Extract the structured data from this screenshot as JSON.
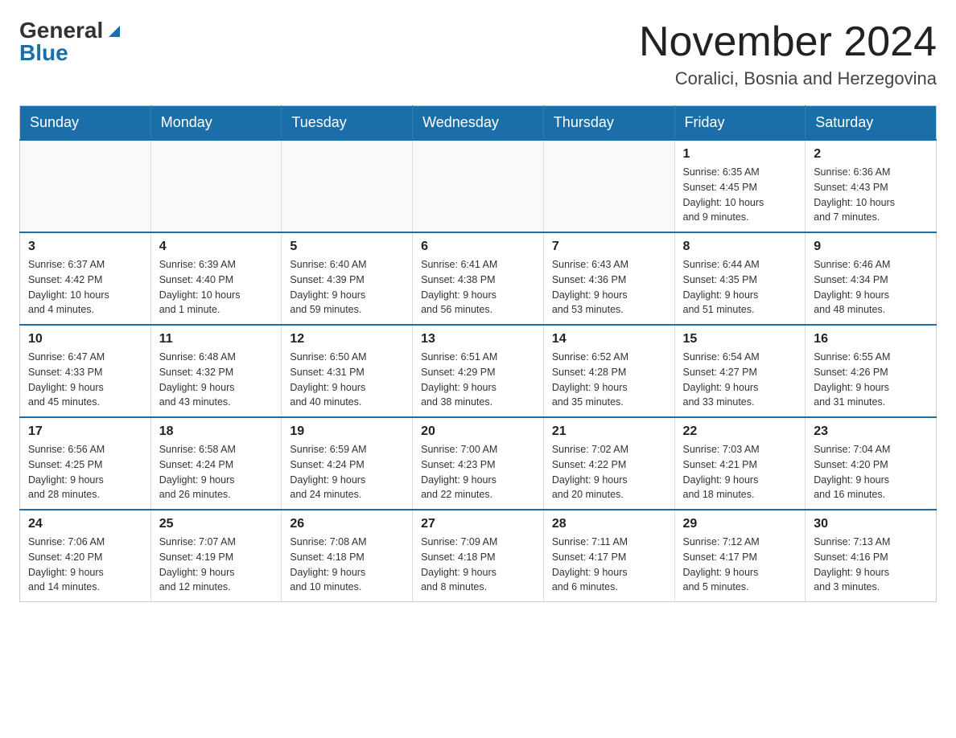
{
  "logo": {
    "general": "General",
    "blue": "Blue"
  },
  "title": {
    "month": "November 2024",
    "location": "Coralici, Bosnia and Herzegovina"
  },
  "days_of_week": [
    "Sunday",
    "Monday",
    "Tuesday",
    "Wednesday",
    "Thursday",
    "Friday",
    "Saturday"
  ],
  "weeks": [
    [
      {
        "day": "",
        "info": ""
      },
      {
        "day": "",
        "info": ""
      },
      {
        "day": "",
        "info": ""
      },
      {
        "day": "",
        "info": ""
      },
      {
        "day": "",
        "info": ""
      },
      {
        "day": "1",
        "info": "Sunrise: 6:35 AM\nSunset: 4:45 PM\nDaylight: 10 hours\nand 9 minutes."
      },
      {
        "day": "2",
        "info": "Sunrise: 6:36 AM\nSunset: 4:43 PM\nDaylight: 10 hours\nand 7 minutes."
      }
    ],
    [
      {
        "day": "3",
        "info": "Sunrise: 6:37 AM\nSunset: 4:42 PM\nDaylight: 10 hours\nand 4 minutes."
      },
      {
        "day": "4",
        "info": "Sunrise: 6:39 AM\nSunset: 4:40 PM\nDaylight: 10 hours\nand 1 minute."
      },
      {
        "day": "5",
        "info": "Sunrise: 6:40 AM\nSunset: 4:39 PM\nDaylight: 9 hours\nand 59 minutes."
      },
      {
        "day": "6",
        "info": "Sunrise: 6:41 AM\nSunset: 4:38 PM\nDaylight: 9 hours\nand 56 minutes."
      },
      {
        "day": "7",
        "info": "Sunrise: 6:43 AM\nSunset: 4:36 PM\nDaylight: 9 hours\nand 53 minutes."
      },
      {
        "day": "8",
        "info": "Sunrise: 6:44 AM\nSunset: 4:35 PM\nDaylight: 9 hours\nand 51 minutes."
      },
      {
        "day": "9",
        "info": "Sunrise: 6:46 AM\nSunset: 4:34 PM\nDaylight: 9 hours\nand 48 minutes."
      }
    ],
    [
      {
        "day": "10",
        "info": "Sunrise: 6:47 AM\nSunset: 4:33 PM\nDaylight: 9 hours\nand 45 minutes."
      },
      {
        "day": "11",
        "info": "Sunrise: 6:48 AM\nSunset: 4:32 PM\nDaylight: 9 hours\nand 43 minutes."
      },
      {
        "day": "12",
        "info": "Sunrise: 6:50 AM\nSunset: 4:31 PM\nDaylight: 9 hours\nand 40 minutes."
      },
      {
        "day": "13",
        "info": "Sunrise: 6:51 AM\nSunset: 4:29 PM\nDaylight: 9 hours\nand 38 minutes."
      },
      {
        "day": "14",
        "info": "Sunrise: 6:52 AM\nSunset: 4:28 PM\nDaylight: 9 hours\nand 35 minutes."
      },
      {
        "day": "15",
        "info": "Sunrise: 6:54 AM\nSunset: 4:27 PM\nDaylight: 9 hours\nand 33 minutes."
      },
      {
        "day": "16",
        "info": "Sunrise: 6:55 AM\nSunset: 4:26 PM\nDaylight: 9 hours\nand 31 minutes."
      }
    ],
    [
      {
        "day": "17",
        "info": "Sunrise: 6:56 AM\nSunset: 4:25 PM\nDaylight: 9 hours\nand 28 minutes."
      },
      {
        "day": "18",
        "info": "Sunrise: 6:58 AM\nSunset: 4:24 PM\nDaylight: 9 hours\nand 26 minutes."
      },
      {
        "day": "19",
        "info": "Sunrise: 6:59 AM\nSunset: 4:24 PM\nDaylight: 9 hours\nand 24 minutes."
      },
      {
        "day": "20",
        "info": "Sunrise: 7:00 AM\nSunset: 4:23 PM\nDaylight: 9 hours\nand 22 minutes."
      },
      {
        "day": "21",
        "info": "Sunrise: 7:02 AM\nSunset: 4:22 PM\nDaylight: 9 hours\nand 20 minutes."
      },
      {
        "day": "22",
        "info": "Sunrise: 7:03 AM\nSunset: 4:21 PM\nDaylight: 9 hours\nand 18 minutes."
      },
      {
        "day": "23",
        "info": "Sunrise: 7:04 AM\nSunset: 4:20 PM\nDaylight: 9 hours\nand 16 minutes."
      }
    ],
    [
      {
        "day": "24",
        "info": "Sunrise: 7:06 AM\nSunset: 4:20 PM\nDaylight: 9 hours\nand 14 minutes."
      },
      {
        "day": "25",
        "info": "Sunrise: 7:07 AM\nSunset: 4:19 PM\nDaylight: 9 hours\nand 12 minutes."
      },
      {
        "day": "26",
        "info": "Sunrise: 7:08 AM\nSunset: 4:18 PM\nDaylight: 9 hours\nand 10 minutes."
      },
      {
        "day": "27",
        "info": "Sunrise: 7:09 AM\nSunset: 4:18 PM\nDaylight: 9 hours\nand 8 minutes."
      },
      {
        "day": "28",
        "info": "Sunrise: 7:11 AM\nSunset: 4:17 PM\nDaylight: 9 hours\nand 6 minutes."
      },
      {
        "day": "29",
        "info": "Sunrise: 7:12 AM\nSunset: 4:17 PM\nDaylight: 9 hours\nand 5 minutes."
      },
      {
        "day": "30",
        "info": "Sunrise: 7:13 AM\nSunset: 4:16 PM\nDaylight: 9 hours\nand 3 minutes."
      }
    ]
  ]
}
